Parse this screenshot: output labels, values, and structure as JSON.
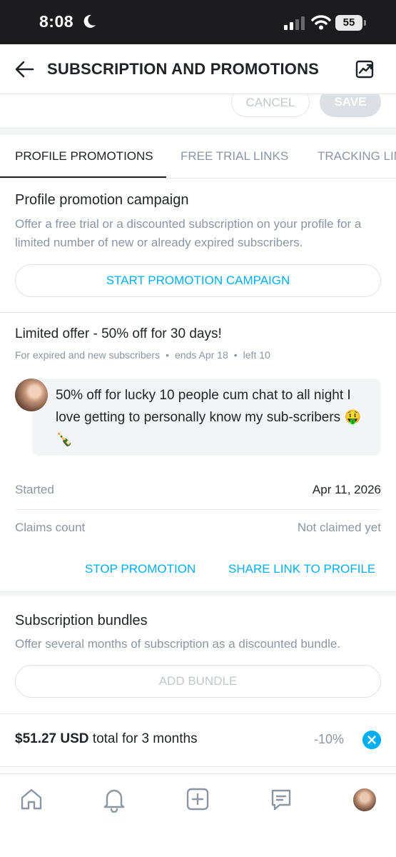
{
  "status_bar": {
    "time": "8:08",
    "battery": "55"
  },
  "header": {
    "title": "SUBSCRIPTION AND PROMOTIONS"
  },
  "actions": {
    "cancel_label": "CANCEL",
    "save_label": "SAVE"
  },
  "tabs": [
    {
      "label": "PROFILE PROMOTIONS",
      "active": true
    },
    {
      "label": "FREE TRIAL LINKS",
      "active": false
    },
    {
      "label": "TRACKING LINKS",
      "active": false
    }
  ],
  "profile_promotion": {
    "title": "Profile promotion campaign",
    "description": "Offer a free trial or a discounted subscription on your profile for a limited number of new or already expired subscribers.",
    "button_label": "START PROMOTION CAMPAIGN"
  },
  "offer": {
    "title": "Limited offer - 50% off for 30 days!",
    "audience": "For expired and new subscribers",
    "ends": "ends Apr 18",
    "left": "left 10",
    "message": "50% off for lucky 10 people cum chat to all night I love getting to personally know my sub-scribers 🤑🍾",
    "started_label": "Started",
    "started_value": "Apr 11, 2026",
    "claims_label": "Claims count",
    "claims_value": "Not claimed yet",
    "stop_label": "STOP PROMOTION",
    "share_label": "SHARE LINK TO PROFILE"
  },
  "bundles": {
    "title": "Subscription bundles",
    "description": "Offer several months of subscription as a discounted bundle.",
    "add_label": "ADD BUNDLE",
    "items": [
      {
        "price": "$51.27 USD",
        "period": "total for 3 months",
        "discount": "-10%"
      }
    ]
  },
  "colors": {
    "accent": "#00aff0",
    "text": "#1f2328",
    "muted": "#8a96a3",
    "divider": "#e4e7eb"
  },
  "icons": {
    "header": [
      "back-arrow-icon",
      "statistics-icon"
    ],
    "nav": [
      "home-icon",
      "bell-icon",
      "add-post-icon",
      "messages-icon",
      "profile-avatar"
    ]
  }
}
